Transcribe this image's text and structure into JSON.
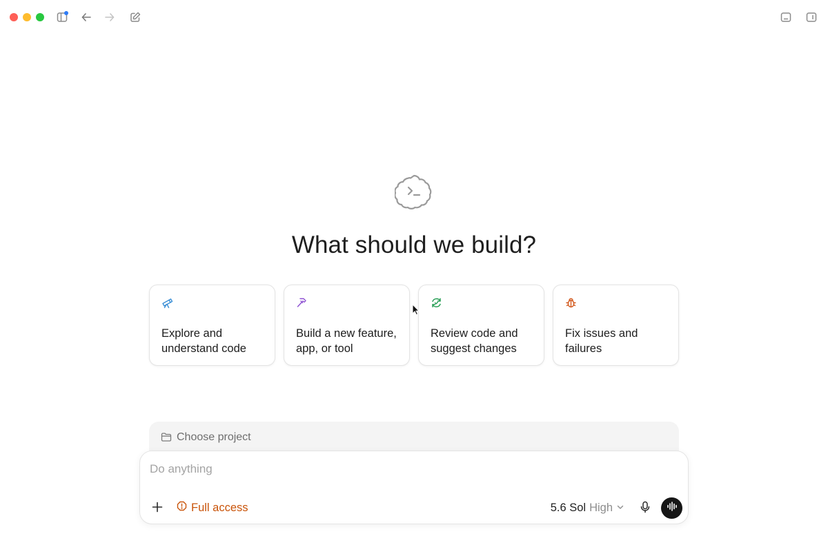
{
  "window": {
    "traffic_lights": [
      "close",
      "minimize",
      "maximize"
    ]
  },
  "toolbar": {
    "icons": [
      "sidebar-toggle-icon",
      "back-arrow-icon",
      "forward-arrow-icon",
      "new-chat-icon",
      "bottom-panel-icon",
      "right-panel-icon"
    ],
    "notification_dot_color": "#2f7cf6"
  },
  "hero": {
    "logo_icon": "terminal-cloud-icon",
    "headline": "What should we build?"
  },
  "cards": [
    {
      "icon": "telescope-icon",
      "icon_color": "#3b8fd6",
      "label": "Explore and understand code"
    },
    {
      "icon": "hammer-icon",
      "icon_color": "#8c4fd1",
      "label": "Build a new feature, app, or tool"
    },
    {
      "icon": "refresh-review-icon",
      "icon_color": "#1f9a4e",
      "label": "Review code and suggest changes"
    },
    {
      "icon": "bug-icon",
      "icon_color": "#d2571a",
      "label": "Fix issues and failures"
    }
  ],
  "composer": {
    "project_label": "Choose project",
    "placeholder": "Do anything",
    "access_label": "Full access",
    "access_color": "#c9540a",
    "model_name": "5.6 Sol",
    "model_level": "High"
  }
}
